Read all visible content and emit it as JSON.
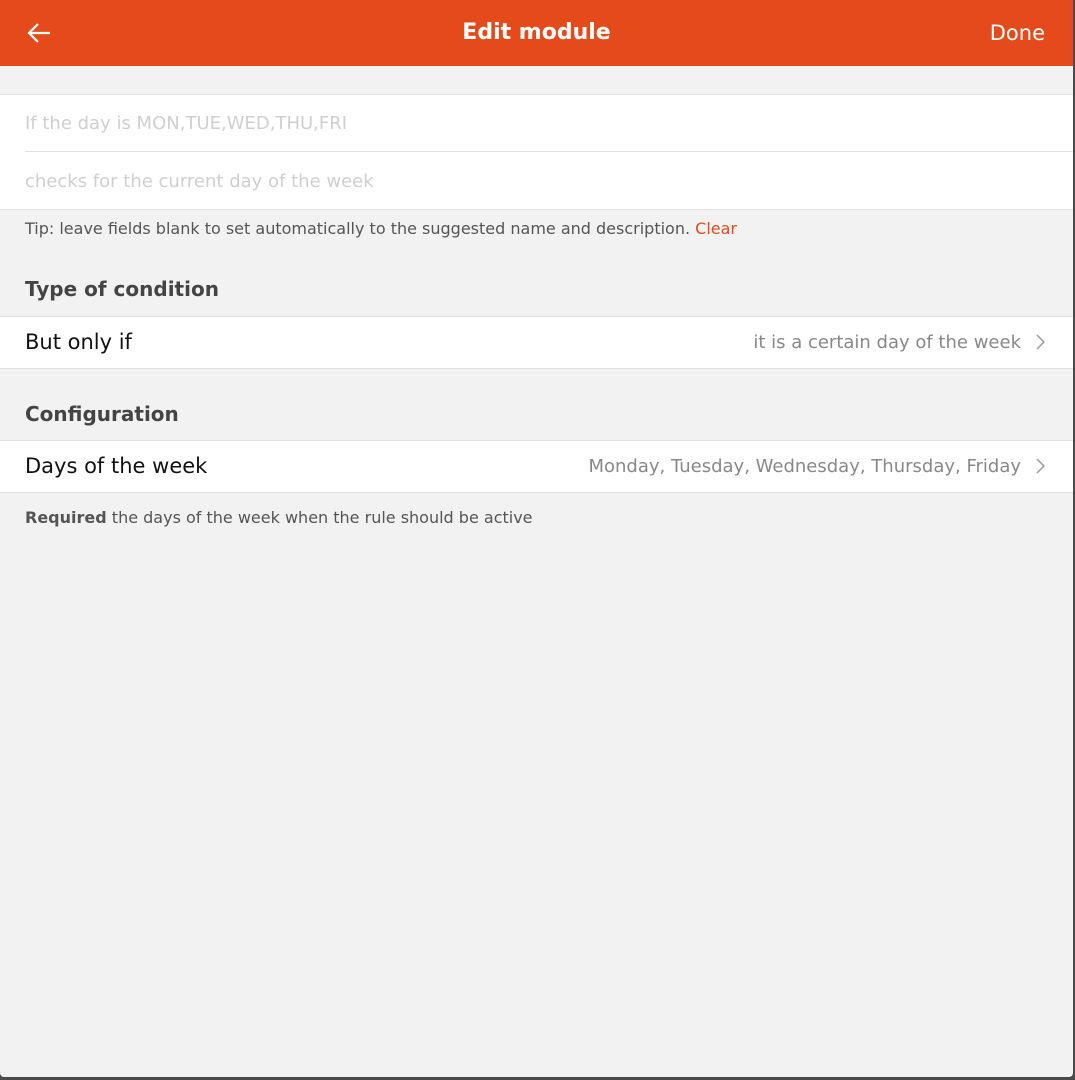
{
  "header": {
    "title": "Edit module",
    "done_label": "Done",
    "back_icon": "arrow-left-icon"
  },
  "fields": {
    "name_placeholder": "If the day is MON,TUE,WED,THU,FRI",
    "description_placeholder": "checks for the current day of the week"
  },
  "tip": {
    "text": "Tip: leave fields blank to set automatically to the suggested name and description.",
    "clear_label": "Clear"
  },
  "type_section": {
    "title": "Type of condition",
    "row": {
      "label": "But only if",
      "value": "it is a certain day of the week"
    }
  },
  "config_section": {
    "title": "Configuration",
    "row": {
      "label": "Days of the week",
      "value": "Monday, Tuesday, Wednesday, Thursday, Friday"
    },
    "note_bold": "Required",
    "note_text": "the days of the week when the rule should be active"
  },
  "colors": {
    "accent": "#e54b1a",
    "background": "#f2f2f2"
  }
}
